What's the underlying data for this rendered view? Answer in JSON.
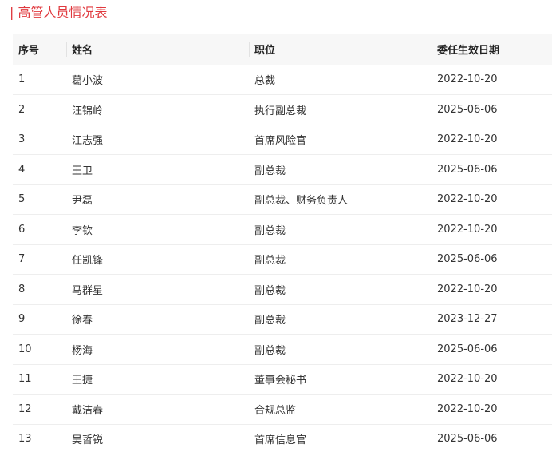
{
  "section_title": "| 高管人员情况表",
  "table": {
    "headers": [
      "序号",
      "姓名",
      "职位",
      "委任生效日期"
    ],
    "rows": [
      [
        "1",
        "葛小波",
        "总裁",
        "2022-10-20"
      ],
      [
        "2",
        "汪锦岭",
        "执行副总裁",
        "2025-06-06"
      ],
      [
        "3",
        "江志强",
        "首席风险官",
        "2022-10-20"
      ],
      [
        "4",
        "王卫",
        "副总裁",
        "2025-06-06"
      ],
      [
        "5",
        "尹磊",
        "副总裁、财务负责人",
        "2022-10-20"
      ],
      [
        "6",
        "李钦",
        "副总裁",
        "2022-10-20"
      ],
      [
        "7",
        "任凯锋",
        "副总裁",
        "2025-06-06"
      ],
      [
        "8",
        "马群星",
        "副总裁",
        "2022-10-20"
      ],
      [
        "9",
        "徐春",
        "副总裁",
        "2023-12-27"
      ],
      [
        "10",
        "杨海",
        "副总裁",
        "2025-06-06"
      ],
      [
        "11",
        "王捷",
        "董事会秘书",
        "2022-10-20"
      ],
      [
        "12",
        "戴洁春",
        "合规总监",
        "2022-10-20"
      ],
      [
        "13",
        "吴哲锐",
        "首席信息官",
        "2025-06-06"
      ]
    ]
  },
  "colors": {
    "title": "#e0393e",
    "header_bg": "#f7f7f7",
    "row_border": "#eeeeee"
  }
}
